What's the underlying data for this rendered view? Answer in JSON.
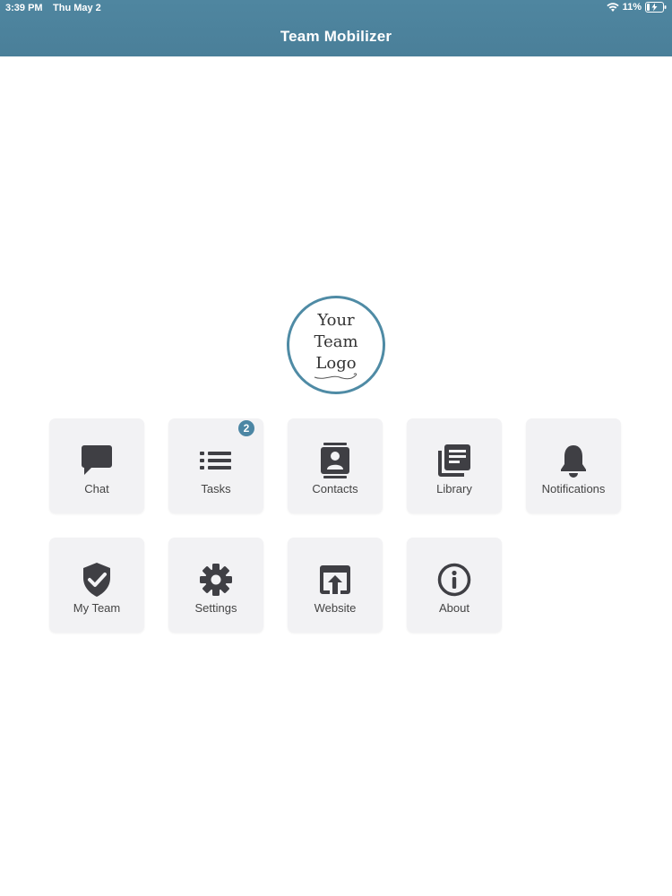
{
  "status_bar": {
    "time": "3:39 PM",
    "date": "Thu May 2",
    "battery": "11%"
  },
  "header": {
    "title": "Team Mobilizer"
  },
  "logo": {
    "line1": "Your",
    "line2": "Team",
    "line3": "Logo"
  },
  "tiles": [
    {
      "label": "Chat",
      "icon": "chat-icon"
    },
    {
      "label": "Tasks",
      "icon": "list-icon",
      "badge": "2"
    },
    {
      "label": "Contacts",
      "icon": "contacts-icon"
    },
    {
      "label": "Library",
      "icon": "library-icon"
    },
    {
      "label": "Notifications",
      "icon": "bell-icon"
    },
    {
      "label": "My Team",
      "icon": "shield-check-icon"
    },
    {
      "label": "Settings",
      "icon": "gear-icon"
    },
    {
      "label": "Website",
      "icon": "external-link-icon"
    },
    {
      "label": "About",
      "icon": "info-icon"
    }
  ],
  "colors": {
    "header": "#4f86a0",
    "icon": "#3f3f44",
    "tile": "#f2f2f4",
    "badge": "#4c86a4"
  }
}
